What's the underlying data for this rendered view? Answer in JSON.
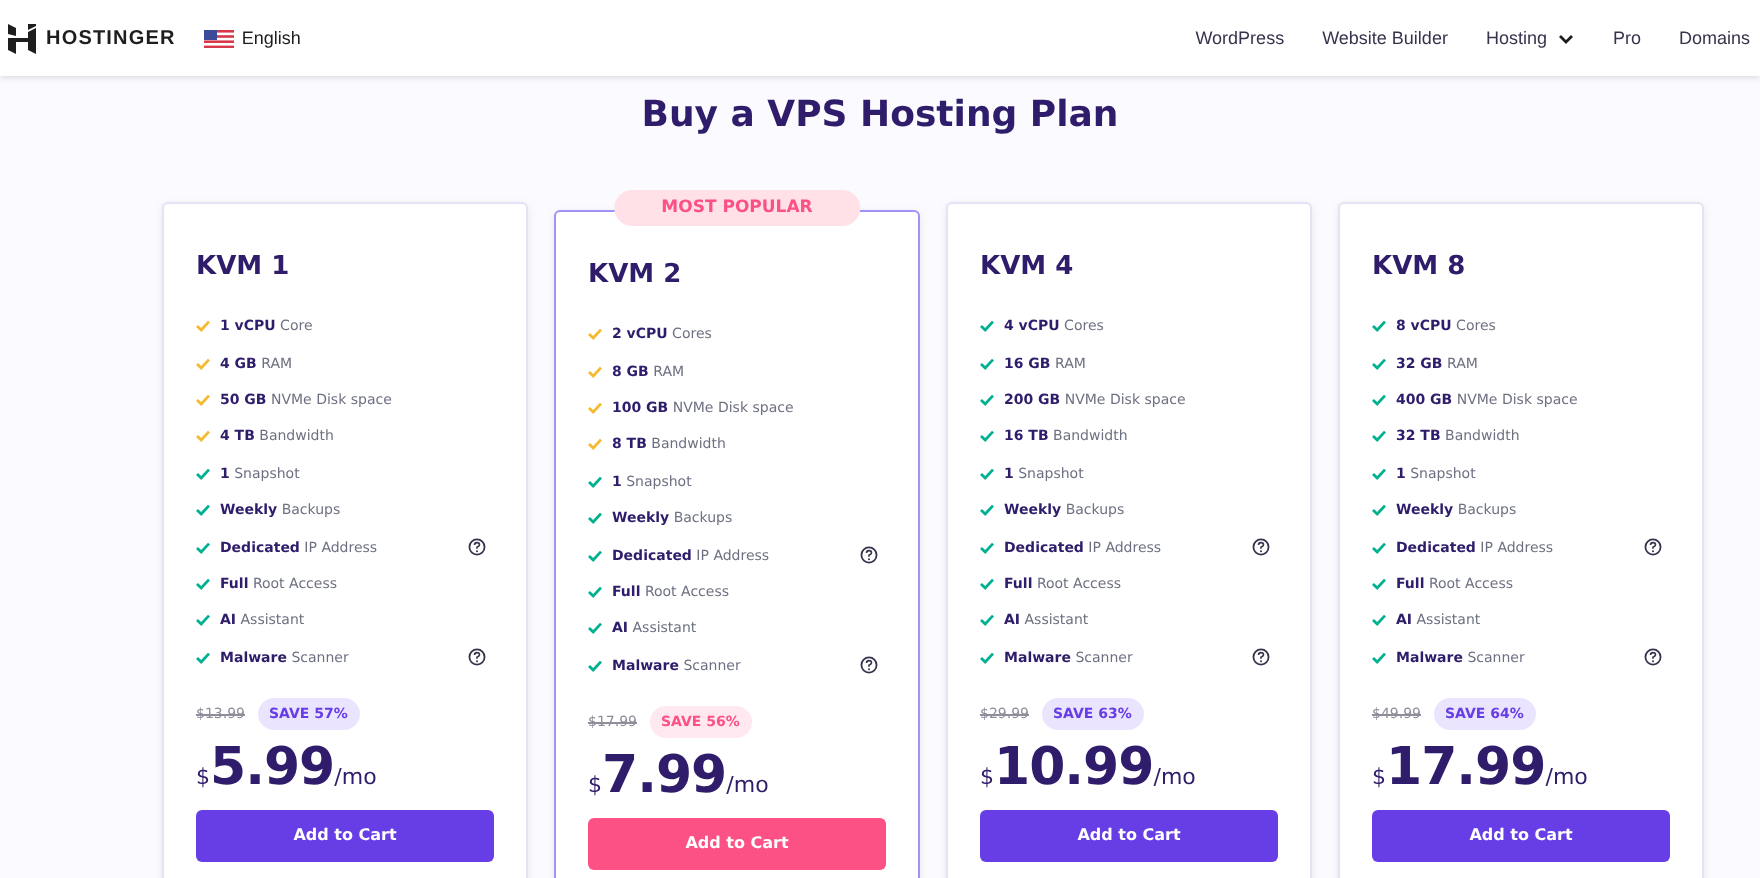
{
  "header": {
    "logo": "HOSTINGER",
    "language": "English",
    "nav": [
      {
        "label": "WordPress",
        "dropdown": false
      },
      {
        "label": "Website Builder",
        "dropdown": false
      },
      {
        "label": "Hosting",
        "dropdown": true
      },
      {
        "label": "Pro",
        "dropdown": false
      },
      {
        "label": "Domains",
        "dropdown": false
      }
    ]
  },
  "title": "Buy a VPS Hosting Plan",
  "plans": [
    {
      "name": "KVM 1",
      "featured": false,
      "features": [
        {
          "text": "**1 vCPU** Core",
          "color": "#f5b82e",
          "help": false
        },
        {
          "text": "**4 GB** RAM",
          "color": "#f5b82e",
          "help": false
        },
        {
          "text": "**50 GB** NVMe Disk space",
          "color": "#f5b82e",
          "help": false
        },
        {
          "text": "**4 TB** Bandwidth",
          "color": "#f5b82e",
          "help": false
        },
        {
          "text": "**1** Snapshot",
          "color": "#00b090",
          "help": false
        },
        {
          "text": "**Weekly** Backups",
          "color": "#00b090",
          "help": false
        },
        {
          "text": "**Dedicated** IP Address",
          "color": "#00b090",
          "help": true
        },
        {
          "text": "**Full** Root Access",
          "color": "#00b090",
          "help": false
        },
        {
          "text": "**AI** Assistant",
          "color": "#00b090",
          "help": false
        },
        {
          "text": "**Malware** Scanner",
          "color": "#00b090",
          "help": true
        }
      ],
      "old_price": "$13.99",
      "save": "SAVE 57%",
      "currency": "$",
      "price": "5.99",
      "period": "/mo",
      "button": "Add to Cart"
    },
    {
      "name": "KVM 2",
      "featured": true,
      "badge": "MOST POPULAR",
      "features": [
        {
          "text": "**2 vCPU** Cores",
          "color": "#f5b82e",
          "help": false
        },
        {
          "text": "**8 GB** RAM",
          "color": "#f5b82e",
          "help": false
        },
        {
          "text": "**100 GB** NVMe Disk space",
          "color": "#f5b82e",
          "help": false
        },
        {
          "text": "**8 TB** Bandwidth",
          "color": "#f5b82e",
          "help": false
        },
        {
          "text": "**1** Snapshot",
          "color": "#00b090",
          "help": false
        },
        {
          "text": "**Weekly** Backups",
          "color": "#00b090",
          "help": false
        },
        {
          "text": "**Dedicated** IP Address",
          "color": "#00b090",
          "help": true
        },
        {
          "text": "**Full** Root Access",
          "color": "#00b090",
          "help": false
        },
        {
          "text": "**AI** Assistant",
          "color": "#00b090",
          "help": false
        },
        {
          "text": "**Malware** Scanner",
          "color": "#00b090",
          "help": true
        }
      ],
      "old_price": "$17.99",
      "save": "SAVE 56%",
      "currency": "$",
      "price": "7.99",
      "period": "/mo",
      "button": "Add to Cart"
    },
    {
      "name": "KVM 4",
      "featured": false,
      "features": [
        {
          "text": "**4 vCPU** Cores",
          "color": "#00b090",
          "help": false
        },
        {
          "text": "**16 GB** RAM",
          "color": "#00b090",
          "help": false
        },
        {
          "text": "**200 GB** NVMe Disk space",
          "color": "#00b090",
          "help": false
        },
        {
          "text": "**16 TB** Bandwidth",
          "color": "#00b090",
          "help": false
        },
        {
          "text": "**1** Snapshot",
          "color": "#00b090",
          "help": false
        },
        {
          "text": "**Weekly** Backups",
          "color": "#00b090",
          "help": false
        },
        {
          "text": "**Dedicated** IP Address",
          "color": "#00b090",
          "help": true
        },
        {
          "text": "**Full** Root Access",
          "color": "#00b090",
          "help": false
        },
        {
          "text": "**AI** Assistant",
          "color": "#00b090",
          "help": false
        },
        {
          "text": "**Malware** Scanner",
          "color": "#00b090",
          "help": true
        }
      ],
      "old_price": "$29.99",
      "save": "SAVE 63%",
      "currency": "$",
      "price": "10.99",
      "period": "/mo",
      "button": "Add to Cart"
    },
    {
      "name": "KVM 8",
      "featured": false,
      "features": [
        {
          "text": "**8 vCPU** Cores",
          "color": "#00b090",
          "help": false
        },
        {
          "text": "**32 GB** RAM",
          "color": "#00b090",
          "help": false
        },
        {
          "text": "**400 GB** NVMe Disk space",
          "color": "#00b090",
          "help": false
        },
        {
          "text": "**32 TB** Bandwidth",
          "color": "#00b090",
          "help": false
        },
        {
          "text": "**1** Snapshot",
          "color": "#00b090",
          "help": false
        },
        {
          "text": "**Weekly** Backups",
          "color": "#00b090",
          "help": false
        },
        {
          "text": "**Dedicated** IP Address",
          "color": "#00b090",
          "help": true
        },
        {
          "text": "**Full** Root Access",
          "color": "#00b090",
          "help": false
        },
        {
          "text": "**AI** Assistant",
          "color": "#00b090",
          "help": false
        },
        {
          "text": "**Malware** Scanner",
          "color": "#00b090",
          "help": true
        }
      ],
      "old_price": "$49.99",
      "save": "SAVE 64%",
      "currency": "$",
      "price": "17.99",
      "period": "/mo",
      "button": "Add to Cart"
    }
  ]
}
